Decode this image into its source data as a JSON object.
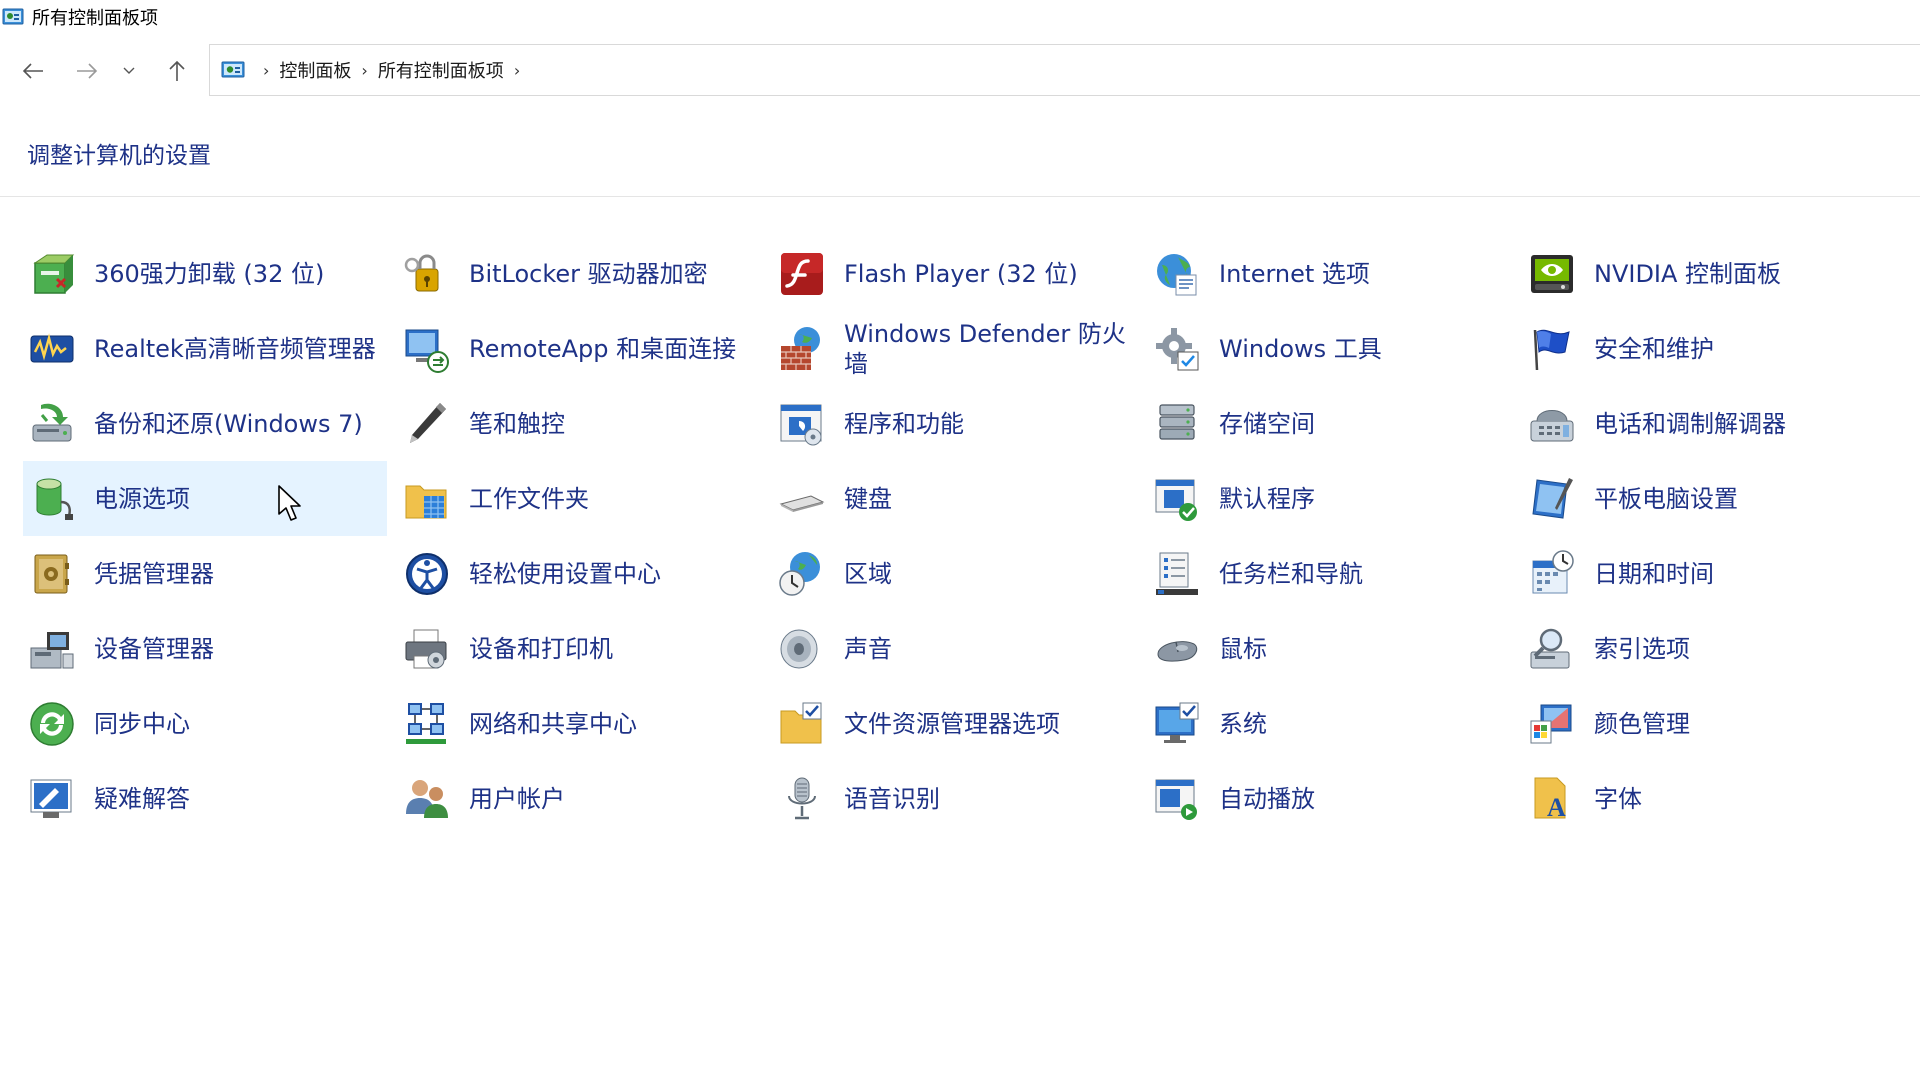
{
  "window": {
    "title": "所有控制面板项",
    "app_icon": "control-panel-icon"
  },
  "nav": {
    "back_icon": "arrow-left-icon",
    "forward_icon": "arrow-right-icon",
    "recent_icon": "chevron-down-icon",
    "up_icon": "arrow-up-icon"
  },
  "address": {
    "icon": "control-panel-icon",
    "crumbs": [
      "控制面板",
      "所有控制面板项"
    ],
    "separator": "›"
  },
  "header": {
    "title": "调整计算机的设置"
  },
  "colors": {
    "link": "#1e3287",
    "hover_bg": "#e5f3ff",
    "divider": "#e5e5e5"
  },
  "items": [
    {
      "label": "360强力卸载 (32 位)",
      "icon": "uninstall-box-icon"
    },
    {
      "label": "BitLocker 驱动器加密",
      "icon": "bitlocker-key-icon"
    },
    {
      "label": "Flash Player (32 位)",
      "icon": "flash-player-icon"
    },
    {
      "label": "Internet 选项",
      "icon": "internet-globe-icon"
    },
    {
      "label": "NVIDIA 控制面板",
      "icon": "nvidia-icon"
    },
    {
      "label": "Realtek高清晰音频管理器",
      "icon": "realtek-audio-icon"
    },
    {
      "label": "RemoteApp 和桌面连接",
      "icon": "remote-desktop-icon"
    },
    {
      "label": "Windows Defender 防火墙",
      "icon": "firewall-icon"
    },
    {
      "label": "Windows 工具",
      "icon": "gear-tools-icon"
    },
    {
      "label": "安全和维护",
      "icon": "flag-icon"
    },
    {
      "label": "备份和还原(Windows 7)",
      "icon": "backup-icon"
    },
    {
      "label": "笔和触控",
      "icon": "pen-icon"
    },
    {
      "label": "程序和功能",
      "icon": "programs-icon"
    },
    {
      "label": "存储空间",
      "icon": "storage-icon"
    },
    {
      "label": "电话和调制解调器",
      "icon": "phone-modem-icon"
    },
    {
      "label": "电源选项",
      "icon": "battery-plug-icon"
    },
    {
      "label": "工作文件夹",
      "icon": "work-folder-icon"
    },
    {
      "label": "键盘",
      "icon": "keyboard-icon"
    },
    {
      "label": "默认程序",
      "icon": "default-programs-icon"
    },
    {
      "label": "平板电脑设置",
      "icon": "tablet-icon"
    },
    {
      "label": "凭据管理器",
      "icon": "credential-safe-icon"
    },
    {
      "label": "轻松使用设置中心",
      "icon": "ease-of-access-icon"
    },
    {
      "label": "区域",
      "icon": "region-globe-clock-icon"
    },
    {
      "label": "任务栏和导航",
      "icon": "taskbar-icon"
    },
    {
      "label": "日期和时间",
      "icon": "calendar-clock-icon"
    },
    {
      "label": "设备管理器",
      "icon": "device-manager-icon"
    },
    {
      "label": "设备和打印机",
      "icon": "printer-icon"
    },
    {
      "label": "声音",
      "icon": "speaker-icon"
    },
    {
      "label": "鼠标",
      "icon": "mouse-icon"
    },
    {
      "label": "索引选项",
      "icon": "index-magnifier-icon"
    },
    {
      "label": "同步中心",
      "icon": "sync-icon"
    },
    {
      "label": "网络和共享中心",
      "icon": "network-icon"
    },
    {
      "label": "文件资源管理器选项",
      "icon": "folder-options-icon"
    },
    {
      "label": "系统",
      "icon": "system-monitor-icon"
    },
    {
      "label": "颜色管理",
      "icon": "color-management-icon"
    },
    {
      "label": "疑难解答",
      "icon": "troubleshoot-icon"
    },
    {
      "label": "用户帐户",
      "icon": "user-accounts-icon"
    },
    {
      "label": "语音识别",
      "icon": "microphone-icon"
    },
    {
      "label": "自动播放",
      "icon": "autoplay-icon"
    },
    {
      "label": "字体",
      "icon": "fonts-icon"
    }
  ],
  "hovered_item": "电源选项",
  "pointer_icon": "mouse-cursor-icon"
}
